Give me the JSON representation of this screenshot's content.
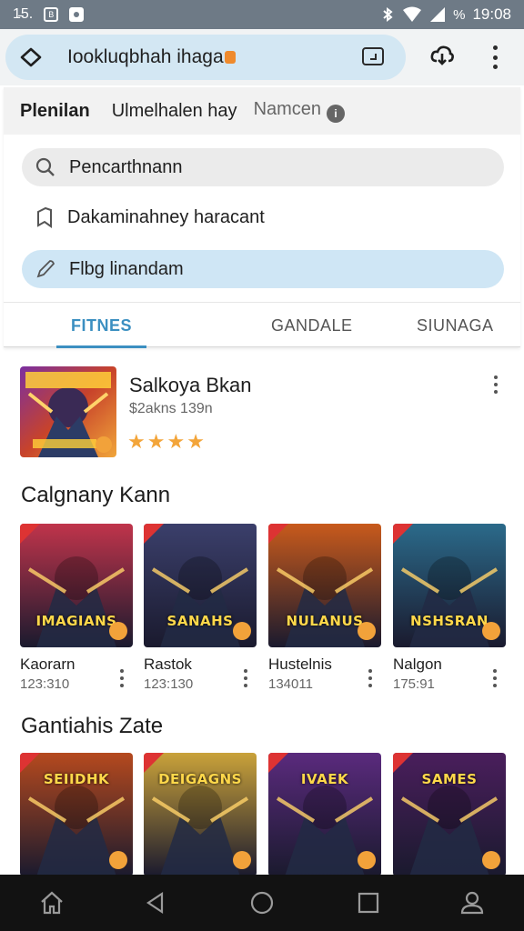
{
  "status_bar": {
    "time_left": "1̵5.",
    "clock": "19:08",
    "icons": [
      "notification-box-icon",
      "media-icon",
      "bluetooth-icon",
      "wifi-icon",
      "signal-icon",
      "battery-icon"
    ]
  },
  "url_bar": {
    "url": "Iookluqbhah ihaga"
  },
  "menu": {
    "headers": [
      "Plenilan",
      "Ulmelhalen hay",
      "Namcen"
    ],
    "search_label": "Pencarthnann",
    "bookmark_label": "Dakaminahney haracant",
    "edit_label": "Flbg linandam"
  },
  "tabs": [
    "FITNES",
    "GANDALE",
    "SIUNAGA"
  ],
  "featured": {
    "title": "Salkoya Bkan",
    "subtitle": "$2akns 139n",
    "rating": 4
  },
  "sections": [
    {
      "title": "Calgnany Kann",
      "games": [
        {
          "name": "Kaorarn",
          "meta": "123:310",
          "art_text": "IMAGIANS",
          "palette": "#c0344b"
        },
        {
          "name": "Rastok",
          "meta": "123:130",
          "art_text": "SANAHS",
          "palette": "#3b3f6b"
        },
        {
          "name": "Hustelnis",
          "meta": "134011",
          "art_text": "NULANUS",
          "palette": "#c85a1c"
        },
        {
          "name": "Nalgon",
          "meta": "175:91",
          "art_text": "NSHSRAN",
          "palette": "#2b6a8a"
        }
      ]
    },
    {
      "title": "Gantiahis Zate",
      "games": [
        {
          "art_text": "SEIIDHK",
          "palette": "#b5491e"
        },
        {
          "art_text": "DEIGAGNS",
          "palette": "#c9a23a"
        },
        {
          "art_text": "IVAEK",
          "palette": "#5a2a7d"
        },
        {
          "art_text": "SAMES",
          "palette": "#4a1e5c"
        }
      ]
    }
  ],
  "colors": {
    "accent": "#3b8fc1",
    "star": "#f3a53a",
    "status_bar": "#6e7a86",
    "nav_bar": "#121212"
  }
}
